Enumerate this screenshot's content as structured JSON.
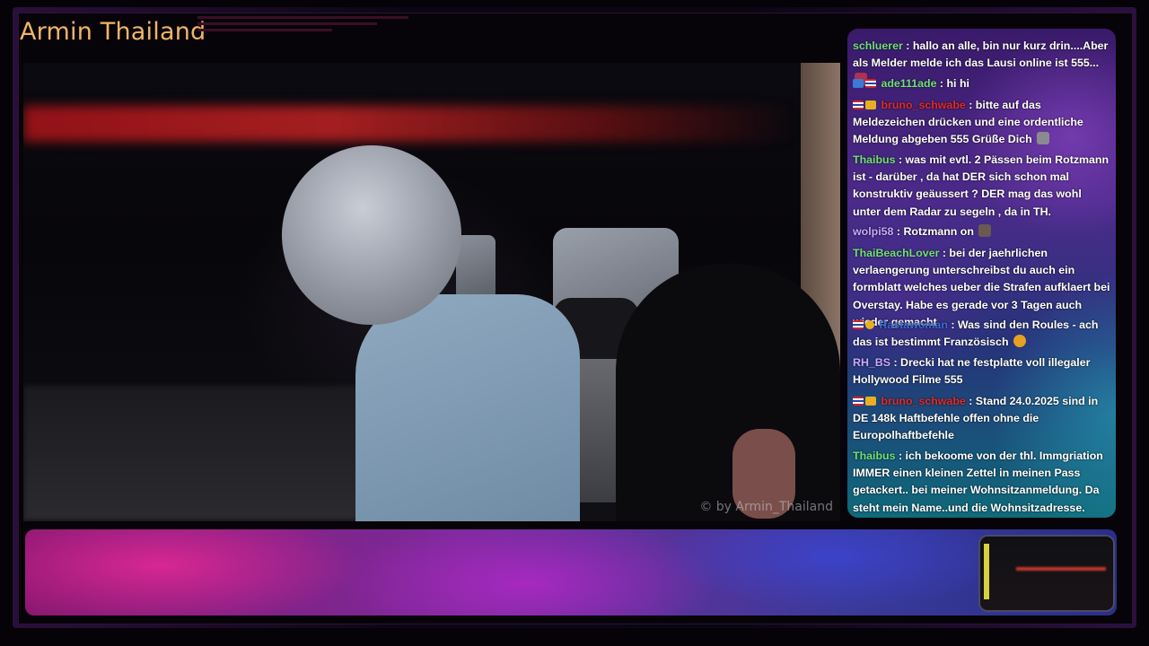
{
  "channel": {
    "title": "Armin Thailand",
    "watermark": "© by Armin_Thailand"
  },
  "chat": {
    "messages": [
      {
        "user": "schluerer",
        "user_color": "#6fe07a",
        "badges": [],
        "text": ": hallo an alle, bin nur kurz drin....Aber als Melder melde ich das Lausi online ist 555...",
        "emote": "heart-emote"
      },
      {
        "user": "ade111ade",
        "user_color": "#6fe07a",
        "badges": [
          "blue",
          "flag"
        ],
        "text": ": hi hi",
        "emote": ""
      },
      {
        "user": "bruno_schwabe",
        "user_color": "#e02a2a",
        "badges": [
          "flag",
          "crown"
        ],
        "text": ": bitte auf das Meldezeichen drücken und eine ordentliche Meldung abgeben 555 Grüße Dich",
        "emote": "wave-emote"
      },
      {
        "user": "Thaibus",
        "user_color": "#6fe07a",
        "badges": [],
        "text": ": was mit evtl. 2 Pässen beim Rotzmann ist - darüber , da hat DER sich schon mal konstruktiv geäussert ? DER mag das wohl unter dem Radar zu segeln , da in TH.",
        "emote": ""
      },
      {
        "user": "wolpi58",
        "user_color": "#c8a8ff",
        "badges": [],
        "text": ": Rotzmann on",
        "emote": "image-emote"
      },
      {
        "user": "ThaiBeachLover",
        "user_color": "#6fe07a",
        "badges": [],
        "text": ": bei der jaehrlichen verlaengerung unterschreibst du auch ein formblatt welches ueber die Strafen aufklaert bei Overstay. Habe es gerade vor 3 Tagen auch wieder gemacht",
        "emote": ""
      },
      {
        "user": "Rastawoman",
        "user_color": "#3a6ad8",
        "badges": [
          "flag",
          "circle"
        ],
        "text": ": Was sind den Roules - ach das ist bestimmt Französisch",
        "emote": "laugh-emote"
      },
      {
        "user": "RH_BS",
        "user_color": "#c8a8ff",
        "badges": [],
        "text": ": Drecki hat ne festplatte voll illegaler Hollywood Filme 555",
        "emote": ""
      },
      {
        "user": "bruno_schwabe",
        "user_color": "#e02a2a",
        "badges": [
          "flag",
          "crown"
        ],
        "text": ": Stand 24.0.2025 sind in DE 148k Haftbefehle offen ohne die Europolhaftbefehle",
        "emote": ""
      },
      {
        "user": "Thaibus",
        "user_color": "#6fe07a",
        "badges": [],
        "text": ": ich bekoome von der thl. Immgriation IMMER einen kleinen Zettel in meinen Pass getackert.. bei meiner Wohnsitzanmeldung. Da steht mein Name..und die Wohnsitzadresse.",
        "emote": ""
      }
    ]
  },
  "colors": {
    "title": "#f0b56a",
    "chat_text": "#ffffff"
  }
}
